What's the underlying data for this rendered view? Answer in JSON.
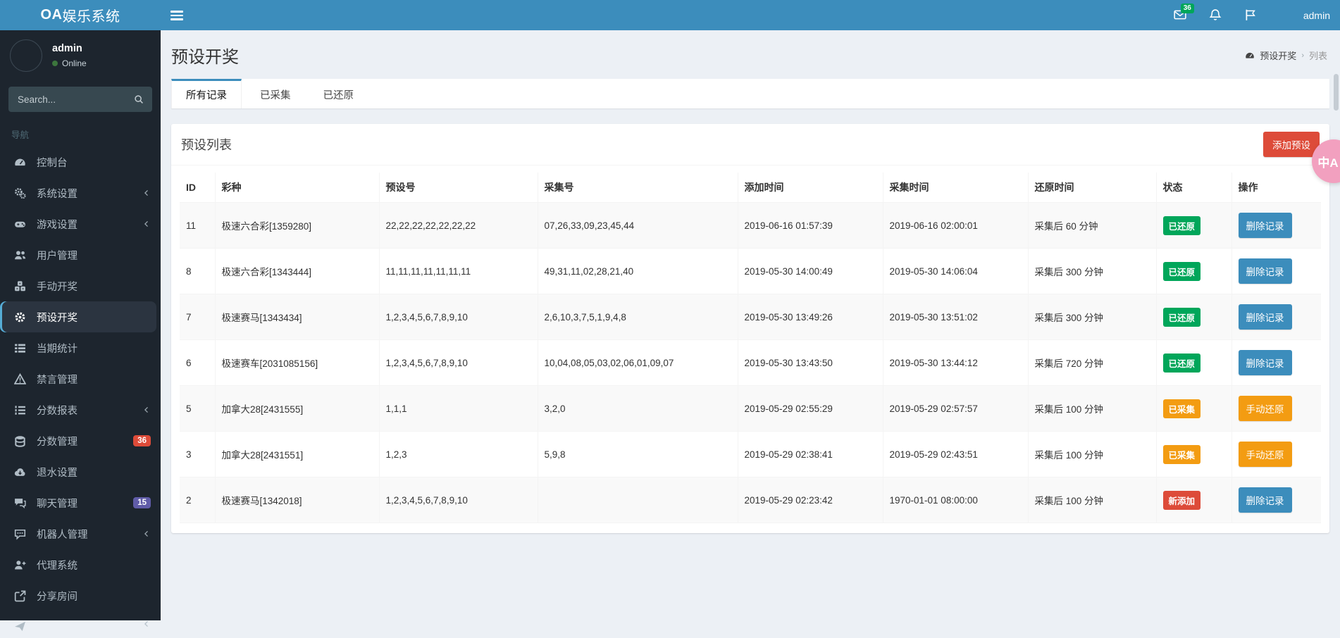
{
  "app": {
    "logo_bold": "OA",
    "logo_rest": "娱乐系统"
  },
  "topbar": {
    "mail_badge": "36",
    "user_name": "admin",
    "icons": [
      "mail-icon",
      "bell-icon",
      "flag-icon"
    ]
  },
  "sidebar": {
    "user": {
      "name": "admin",
      "status": "Online"
    },
    "search_placeholder": "Search...",
    "nav_header": "导航",
    "items": [
      {
        "label": "控制台",
        "icon": "dashboard-icon",
        "chevron": false,
        "active": false
      },
      {
        "label": "系统设置",
        "icon": "gears-icon",
        "chevron": true,
        "active": false
      },
      {
        "label": "游戏设置",
        "icon": "gamepad-icon",
        "chevron": true,
        "active": false
      },
      {
        "label": "用户管理",
        "icon": "users-icon",
        "chevron": false,
        "active": false
      },
      {
        "label": "手动开奖",
        "icon": "cubes-icon",
        "chevron": false,
        "active": false
      },
      {
        "label": "预设开奖",
        "icon": "gear-icon",
        "chevron": false,
        "active": true
      },
      {
        "label": "当期统计",
        "icon": "list-icon",
        "chevron": false,
        "active": false
      },
      {
        "label": "禁言管理",
        "icon": "warning-icon",
        "chevron": false,
        "active": false
      },
      {
        "label": "分数报表",
        "icon": "list-ol-icon",
        "chevron": true,
        "active": false
      },
      {
        "label": "分数管理",
        "icon": "database-icon",
        "chevron": false,
        "active": false,
        "badge": "36",
        "badge_color": "#dd4b39"
      },
      {
        "label": "退水设置",
        "icon": "cloud-download-icon",
        "chevron": false,
        "active": false
      },
      {
        "label": "聊天管理",
        "icon": "comments-icon",
        "chevron": false,
        "active": false,
        "badge": "15",
        "badge_color": "#605ca8"
      },
      {
        "label": "机器人管理",
        "icon": "robot-chat-icon",
        "chevron": true,
        "active": false
      },
      {
        "label": "代理系统",
        "icon": "user-plus-icon",
        "chevron": false,
        "active": false
      },
      {
        "label": "分享房间",
        "icon": "share-icon",
        "chevron": false,
        "active": false
      },
      {
        "label": "",
        "icon": "send-icon",
        "chevron": true,
        "active": false,
        "cut": true
      }
    ]
  },
  "page": {
    "title": "预设开奖",
    "breadcrumb": {
      "root": "预设开奖",
      "sep": "›",
      "current": "列表"
    },
    "tabs": [
      {
        "label": "所有记录",
        "active": true
      },
      {
        "label": "已采集",
        "active": false
      },
      {
        "label": "已还原",
        "active": false
      }
    ]
  },
  "box": {
    "title": "预设列表",
    "add_button_label": "添加预设"
  },
  "table": {
    "headers": [
      "ID",
      "彩种",
      "预设号",
      "采集号",
      "添加时间",
      "采集时间",
      "还原时间",
      "状态",
      "操作"
    ],
    "rows": [
      {
        "id": "11",
        "lottery": "极速六合彩[1359280]",
        "preset": "22,22,22,22,22,22,22",
        "collected": "07,26,33,09,23,45,44",
        "added_at": "2019-06-16 01:57:39",
        "collected_at": "2019-06-16 02:00:01",
        "restore_after": "采集后 60 分钟",
        "status": "已还原",
        "status_type": "restored",
        "action": "删除记录",
        "action_type": "delete"
      },
      {
        "id": "8",
        "lottery": "极速六合彩[1343444]",
        "preset": "11,11,11,11,11,11,11",
        "collected": "49,31,11,02,28,21,40",
        "added_at": "2019-05-30 14:00:49",
        "collected_at": "2019-05-30 14:06:04",
        "restore_after": "采集后 300 分钟",
        "status": "已还原",
        "status_type": "restored",
        "action": "删除记录",
        "action_type": "delete"
      },
      {
        "id": "7",
        "lottery": "极速赛马[1343434]",
        "preset": "1,2,3,4,5,6,7,8,9,10",
        "collected": "2,6,10,3,7,5,1,9,4,8",
        "added_at": "2019-05-30 13:49:26",
        "collected_at": "2019-05-30 13:51:02",
        "restore_after": "采集后 300 分钟",
        "status": "已还原",
        "status_type": "restored",
        "action": "删除记录",
        "action_type": "delete"
      },
      {
        "id": "6",
        "lottery": "极速赛车[2031085156]",
        "preset": "1,2,3,4,5,6,7,8,9,10",
        "collected": "10,04,08,05,03,02,06,01,09,07",
        "added_at": "2019-05-30 13:43:50",
        "collected_at": "2019-05-30 13:44:12",
        "restore_after": "采集后 720 分钟",
        "status": "已还原",
        "status_type": "restored",
        "action": "删除记录",
        "action_type": "delete"
      },
      {
        "id": "5",
        "lottery": "加拿大28[2431555]",
        "preset": "1,1,1",
        "collected": "3,2,0",
        "added_at": "2019-05-29 02:55:29",
        "collected_at": "2019-05-29 02:57:57",
        "restore_after": "采集后 100 分钟",
        "status": "已采集",
        "status_type": "collected",
        "action": "手动还原",
        "action_type": "restore"
      },
      {
        "id": "3",
        "lottery": "加拿大28[2431551]",
        "preset": "1,2,3",
        "collected": "5,9,8",
        "added_at": "2019-05-29 02:38:41",
        "collected_at": "2019-05-29 02:43:51",
        "restore_after": "采集后 100 分钟",
        "status": "已采集",
        "status_type": "collected",
        "action": "手动还原",
        "action_type": "restore"
      },
      {
        "id": "2",
        "lottery": "极速赛马[1342018]",
        "preset": "1,2,3,4,5,6,7,8,9,10",
        "collected": "",
        "added_at": "2019-05-29 02:23:42",
        "collected_at": "1970-01-01 08:00:00",
        "restore_after": "采集后 100 分钟",
        "status": "新添加",
        "status_type": "new",
        "action": "删除记录",
        "action_type": "delete"
      }
    ]
  },
  "floating": {
    "translate_label": "中A"
  },
  "colors": {
    "accent": "#3c8dbc",
    "success": "#00a65a",
    "warning": "#f39c12",
    "danger": "#dd4b39",
    "purple_badge": "#605ca8",
    "sidebar_bg": "#1d252e"
  }
}
